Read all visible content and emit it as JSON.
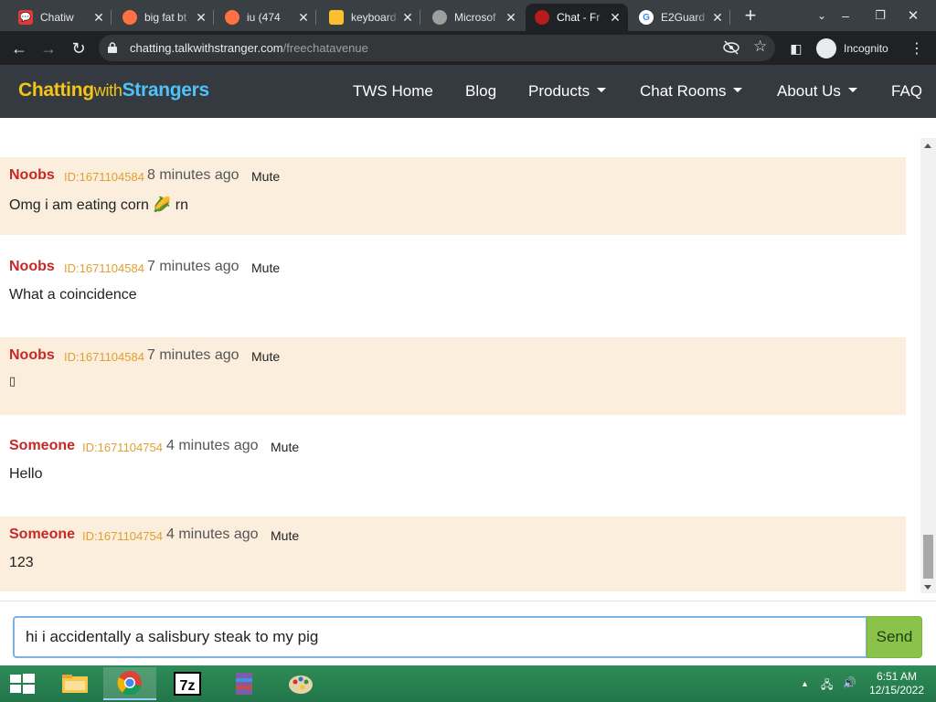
{
  "browser": {
    "tabs": [
      {
        "title": "Chatiw",
        "fav_color": "#e53935",
        "active": false
      },
      {
        "title": "big fat bt",
        "fav_color": "#ff7043",
        "active": false
      },
      {
        "title": "iu (474",
        "fav_color": "#ff7043",
        "active": false
      },
      {
        "title": "keyboard",
        "fav_color": "#fbc02d",
        "active": false
      },
      {
        "title": "Microsof",
        "fav_color": "#9e9e9e",
        "active": false
      },
      {
        "title": "Chat - Fr",
        "fav_color": "#b71c1c",
        "active": true
      },
      {
        "title": "E2Guard",
        "fav_color": "#4285f4",
        "active": false
      }
    ],
    "url_host": "chatting.talkwithstranger.com",
    "url_path": "/freechatavenue",
    "incognito_label": "Incognito"
  },
  "site": {
    "brand_part1": "Chatting",
    "brand_part2": "with",
    "brand_part3": "Strangers",
    "nav": {
      "home": "TWS Home",
      "blog": "Blog",
      "products": "Products",
      "chat_rooms": "Chat Rooms",
      "about": "About Us",
      "faq": "FAQ"
    }
  },
  "messages": [
    {
      "name": "Noobs",
      "id": "ID:1671104584",
      "time": "8 minutes ago",
      "mute": "Mute",
      "text": "Omg i am eating corn 🌽 rn"
    },
    {
      "name": "Noobs",
      "id": "ID:1671104584",
      "time": "7 minutes ago",
      "mute": "Mute",
      "text": "What a coincidence"
    },
    {
      "name": "Noobs",
      "id": "ID:1671104584",
      "time": "7 minutes ago",
      "mute": "Mute",
      "text": "▯"
    },
    {
      "name": "Someone",
      "id": "ID:1671104754",
      "time": "4 minutes ago",
      "mute": "Mute",
      "text": "Hello"
    },
    {
      "name": "Someone",
      "id": "ID:1671104754",
      "time": "4 minutes ago",
      "mute": "Mute",
      "text": "123"
    }
  ],
  "compose": {
    "value": "hi i accidentally a salisbury steak to my pig",
    "send_label": "Send"
  },
  "taskbar": {
    "time": "6:51 AM",
    "date": "12/15/2022"
  }
}
